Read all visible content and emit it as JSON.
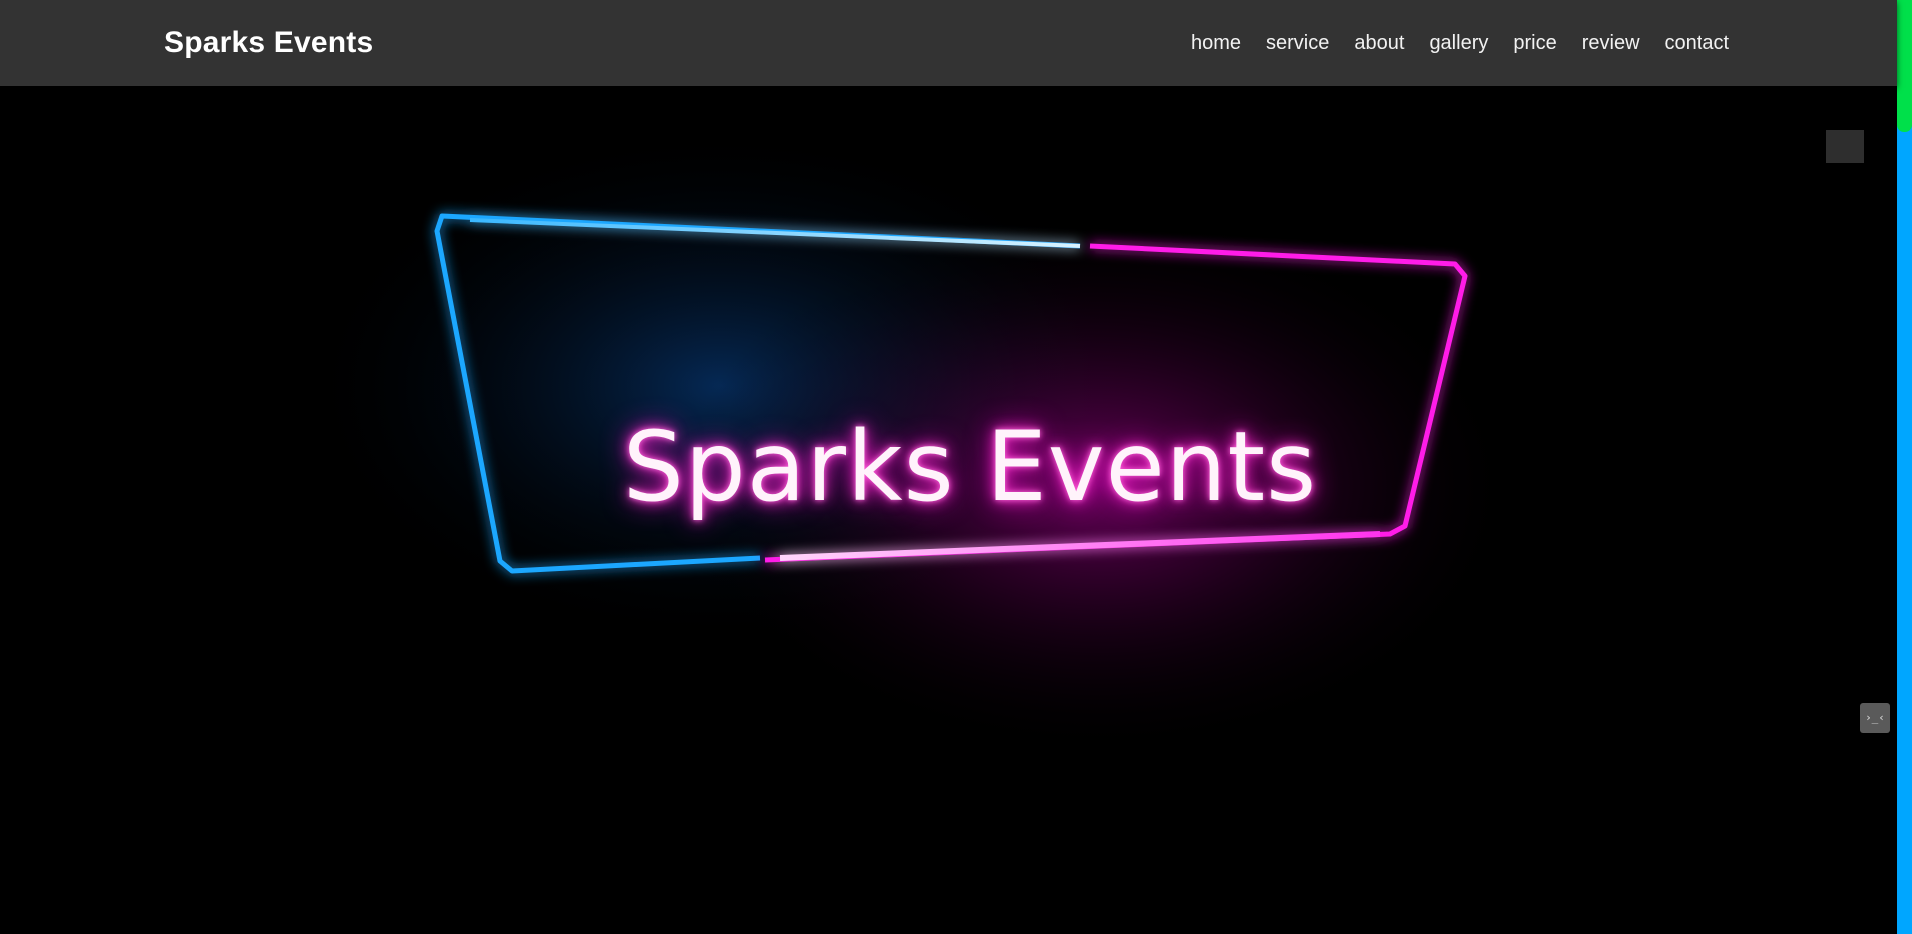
{
  "header": {
    "logo": "Sparks Events",
    "nav": [
      "home",
      "service",
      "about",
      "gallery",
      "price",
      "review",
      "contact"
    ]
  },
  "hero": {
    "title": "Sparks Events"
  },
  "widgets": {
    "mini_icon": "›_‹"
  },
  "colors": {
    "header_bg": "#333333",
    "neon_blue": "#1aa7ff",
    "neon_pink": "#ff1ee8",
    "scrollbar_track": "#00a6ff",
    "scrollbar_thumb": "#00e04a"
  }
}
